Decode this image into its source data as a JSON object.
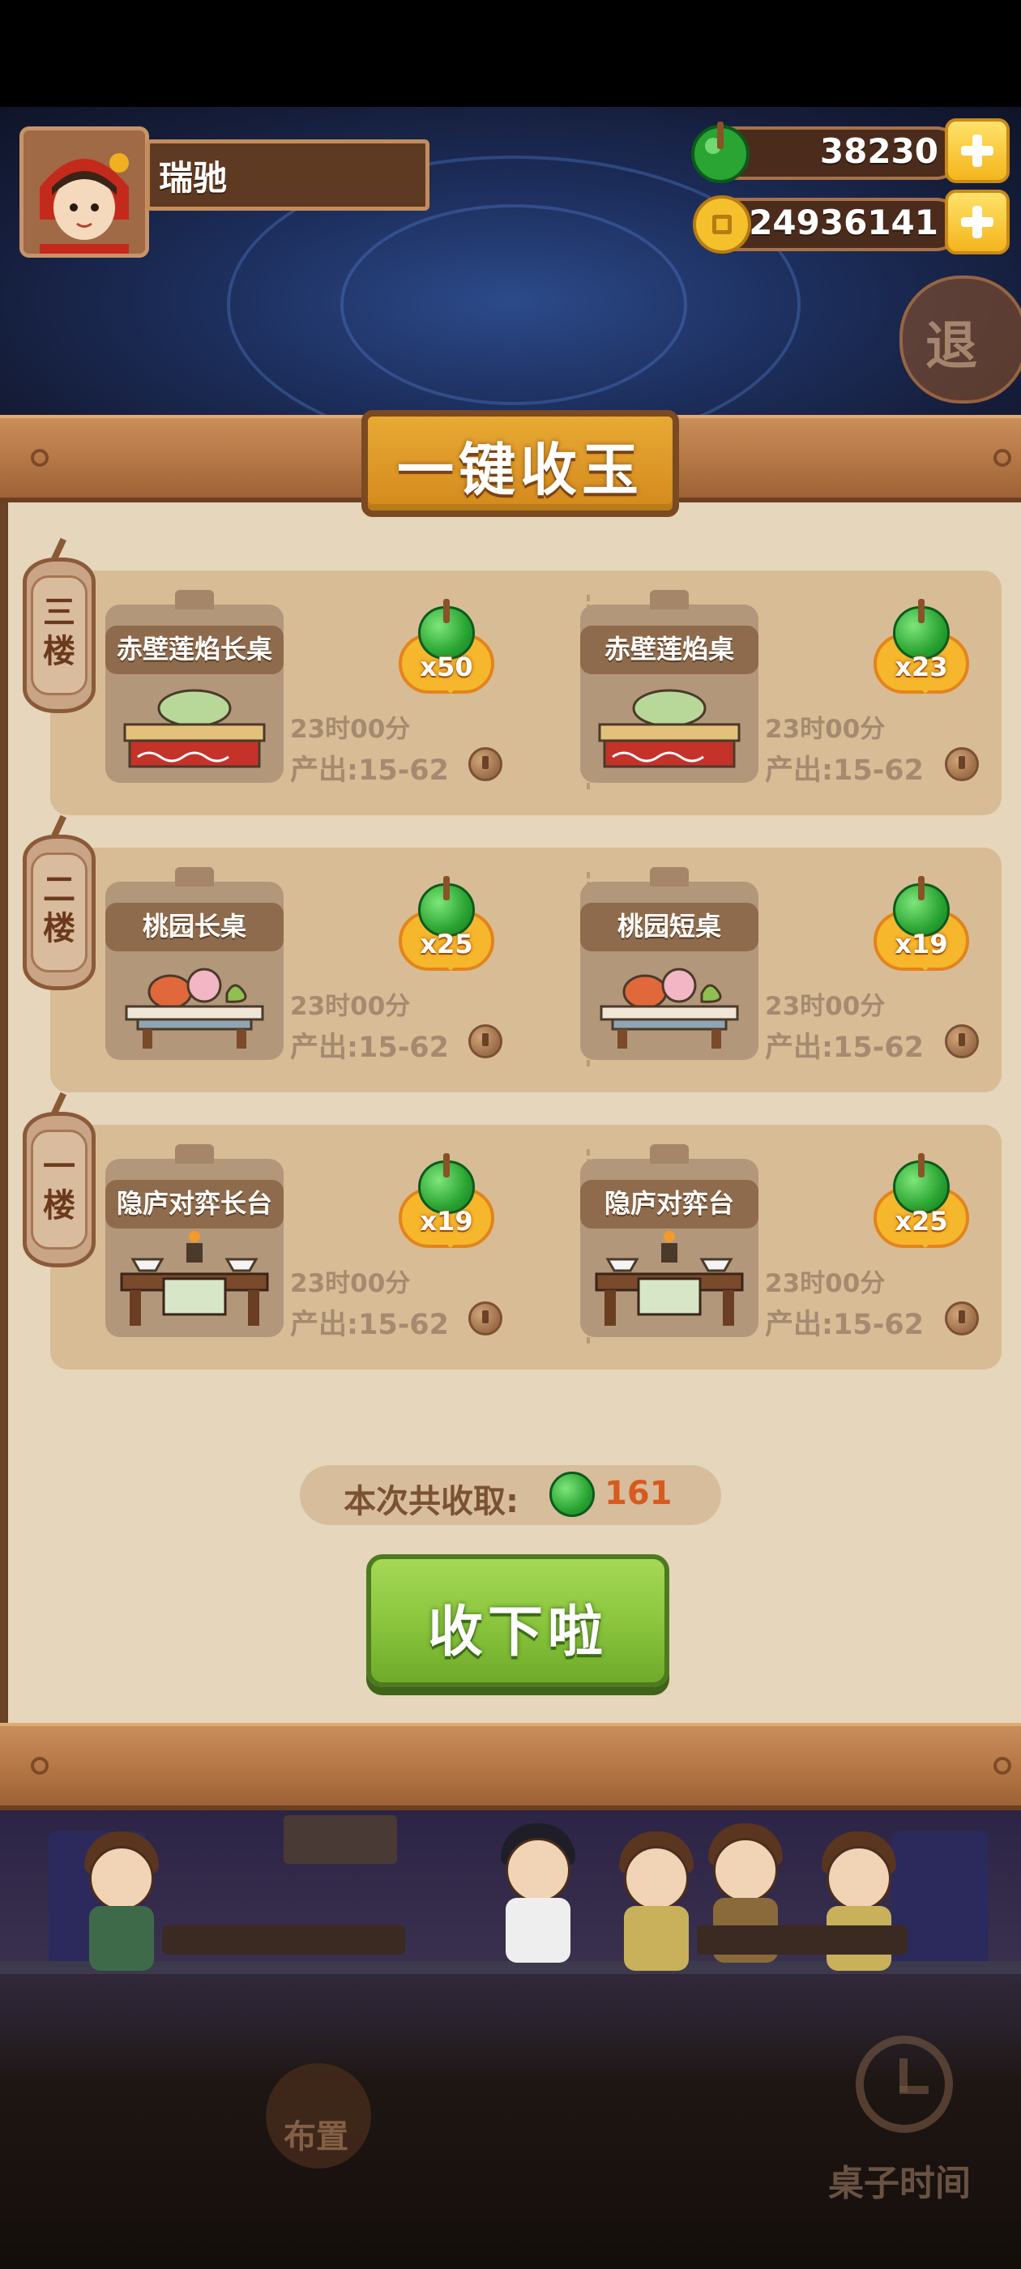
{
  "header": {
    "player_name": "瑞驰",
    "jade_amount": "38230",
    "coin_amount": "24936141",
    "exit_label": "退"
  },
  "panel": {
    "title": "一键收玉",
    "floors": [
      {
        "label": "三\n楼",
        "items": [
          {
            "name": "赤壁莲焰长桌",
            "qty": "x50",
            "time": "23时00分",
            "output": "产出:15-62"
          },
          {
            "name": "赤壁莲焰桌",
            "qty": "x23",
            "time": "23时00分",
            "output": "产出:15-62"
          }
        ]
      },
      {
        "label": "二\n楼",
        "items": [
          {
            "name": "桃园长桌",
            "qty": "x25",
            "time": "23时00分",
            "output": "产出:15-62"
          },
          {
            "name": "桃园短桌",
            "qty": "x19",
            "time": "23时00分",
            "output": "产出:15-62"
          }
        ]
      },
      {
        "label": "一\n楼",
        "items": [
          {
            "name": "隐庐对弈长台",
            "qty": "x19",
            "time": "23时00分",
            "output": "产出:15-62"
          },
          {
            "name": "隐庐对弈台",
            "qty": "x25",
            "time": "23时00分",
            "output": "产出:15-62"
          }
        ]
      }
    ],
    "total_label": "本次共收取:",
    "total_value": "161",
    "collect_button": "收下啦"
  },
  "bottom": {
    "layout_label": "布置",
    "table_time_label": "桌子时间"
  },
  "colors": {
    "jade": "#2aa432",
    "gold": "#f6b72c",
    "collect_green": "#8cc63e",
    "total_red": "#d85a1f"
  }
}
